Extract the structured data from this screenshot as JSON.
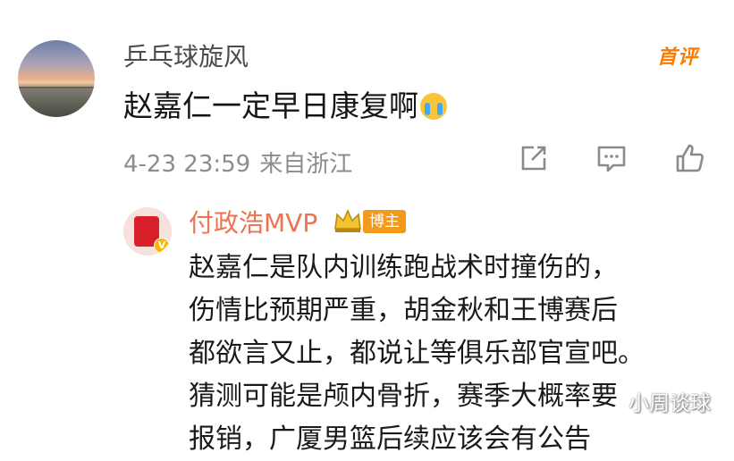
{
  "comment": {
    "username": "乒乓球旋风",
    "text": "赵嘉仁一定早日康复啊",
    "emoji": "crying-emoji",
    "badge": "首评",
    "timestamp": "4-23 23:59",
    "location": "来自浙江",
    "actions": [
      "share-icon",
      "comment-icon",
      "like-icon"
    ]
  },
  "reply": {
    "username": "付政浩MVP",
    "badge": "博主",
    "lines": [
      "赵嘉仁是队内训练跑战术时撞伤的，",
      "伤情比预期严重，胡金秋和王博赛后",
      "都欲言又止，都说让等俱乐部官宣吧。",
      "猜测可能是颅内骨折，赛季大概率要",
      "报销，广厦男篮后续应该会有公告"
    ]
  },
  "watermark": "小周谈球",
  "colors": {
    "reply_name": "#eb7350",
    "badge_orange": "#f29a1b",
    "first_badge": "#ff7a00"
  }
}
